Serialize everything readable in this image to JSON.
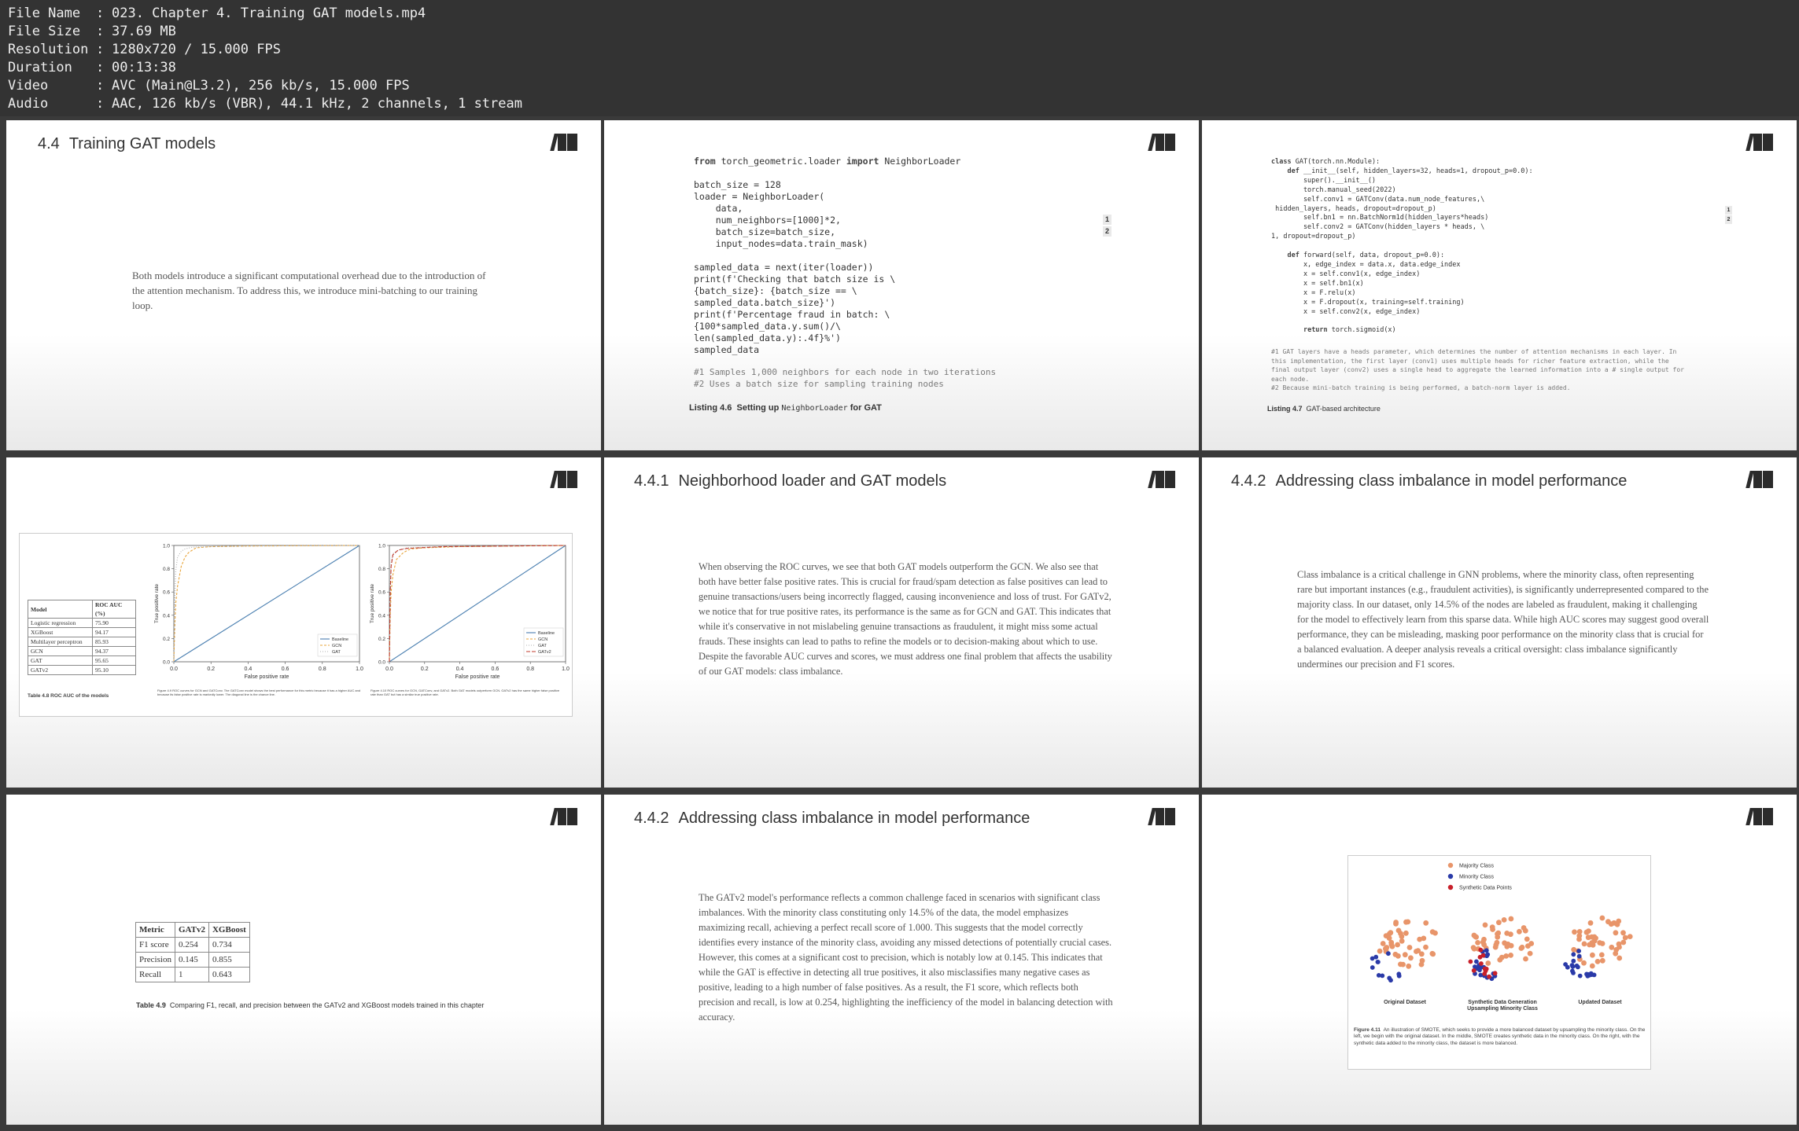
{
  "header": {
    "rows": [
      {
        "key": "File Name",
        "sep": ":",
        "value": "023. Chapter 4. Training GAT models.mp4"
      },
      {
        "key": "File Size",
        "sep": ":",
        "value": "37.69 MB"
      },
      {
        "key": "Resolution",
        "sep": ":",
        "value": "1280x720 / 15.000 FPS"
      },
      {
        "key": "Duration",
        "sep": ":",
        "value": "00:13:38"
      },
      {
        "key": "Video",
        "sep": ":",
        "value": "AVC (Main@L3.2), 256 kb/s, 15.000 FPS"
      },
      {
        "key": "Audio",
        "sep": ":",
        "value": "AAC, 126 kb/s (VBR), 44.1 kHz, 2 channels, 1 stream"
      }
    ]
  },
  "p1": {
    "num": "4.4",
    "title": "Training GAT models",
    "text": "Both models introduce a significant computational overhead due to the introduction of the attention mechanism. To address this, we introduce mini-batching to our training loop."
  },
  "p2": {
    "code": [
      "from torch_geometric.loader import NeighborLoader",
      "",
      "batch_size = 128",
      "loader = NeighborLoader(",
      "    data,",
      "    num_neighbors=[1000]*2,",
      "    batch_size=batch_size,",
      "    input_nodes=data.train_mask)",
      "",
      "sampled_data = next(iter(loader))",
      "print(f'Checking that batch size is \\",
      "{batch_size}: {batch_size == \\",
      "sampled_data.batch_size}')",
      "print(f'Percentage fraud in batch: \\",
      "{100*sampled_data.y.sum()/\\",
      "len(sampled_data.y):.4f}%')",
      "sampled_data"
    ],
    "comments": [
      "#1 Samples 1,000 neighbors for each node in two iterations",
      "#2 Uses a batch size for sampling training nodes"
    ],
    "badges": [
      "1",
      "2"
    ],
    "caption_label": "Listing 4.6",
    "caption_pre": "Setting up",
    "caption_code": "NeighborLoader",
    "caption_post": "for GAT"
  },
  "p3": {
    "code": [
      "class GAT(torch.nn.Module):",
      "    def __init__(self, hidden_layers=32, heads=1, dropout_p=0.0):",
      "        super().__init__()",
      "        torch.manual_seed(2022)",
      "        self.conv1 = GATConv(data.num_node_features,\\",
      " hidden_layers, heads, dropout=dropout_p)",
      "        self.bn1 = nn.BatchNorm1d(hidden_layers*heads)",
      "        self.conv2 = GATConv(hidden_layers * heads, \\",
      "1, dropout=dropout_p)",
      "",
      "    def forward(self, data, dropout_p=0.0):",
      "        x, edge_index = data.x, data.edge_index",
      "        x = self.conv1(x, edge_index)",
      "        x = self.bn1(x)",
      "        x = F.relu(x)",
      "        x = F.dropout(x, training=self.training)",
      "        x = self.conv2(x, edge_index)",
      "",
      "        return torch.sigmoid(x)"
    ],
    "comments": [
      "#1 GAT layers have a heads parameter, which determines the number of attention mechanisms in each layer. In",
      "this implementation, the first layer (conv1) uses multiple heads for richer feature extraction, while the",
      "final output layer (conv2) uses a single head to aggregate the learned information into a # single output for",
      "each node.",
      "#2 Because mini-batch training is being performed, a batch-norm layer is added."
    ],
    "badges": [
      "1",
      "2"
    ],
    "caption_label": "Listing 4.7",
    "caption_text": "GAT-based architecture"
  },
  "p4": {
    "table_headers": [
      "Model",
      "ROC AUC (%)"
    ],
    "table_rows": [
      [
        "Logistic regression",
        "75.90"
      ],
      [
        "XGBoost",
        "94.17"
      ],
      [
        "Multilayer perceptron",
        "85.93"
      ],
      [
        "GCN",
        "94.37"
      ],
      [
        "GAT",
        "95.65"
      ],
      [
        "GATv2",
        "95.10"
      ]
    ],
    "table_caption": "Table 4.8 ROC AUC of the models",
    "fig1_caption": "Figure 4.9 ROC curves for GCN and GATConv. The GATConv model shows the best performance for this metric because it has a higher AUC and because its false positive rate is markedly lower. The diagonal line is the chance line.",
    "fig2_caption": "Figure 4.10 ROC curves for GCN, GATConv, and GATv2. Both GAT models outperform GCN. GATv2 has the same higher false positive rate than GAT but has a similar true positive rate."
  },
  "chart_data": [
    {
      "type": "line",
      "xlabel": "False positive rate",
      "ylabel": "True positive rate",
      "xlim": [
        0,
        1
      ],
      "ylim": [
        0,
        1
      ],
      "xticks": [
        "0.0",
        "0.2",
        "0.4",
        "0.6",
        "0.8",
        "1.0"
      ],
      "yticks": [
        "0.0",
        "0.2",
        "0.4",
        "0.6",
        "0.8",
        "1.0"
      ],
      "legend": "bottom-right",
      "series": [
        {
          "name": "Baseline",
          "color": "#4a7fb0",
          "dash": "",
          "x": [
            0,
            1
          ],
          "y": [
            0,
            1
          ]
        },
        {
          "name": "GCN",
          "color": "#e8a43a",
          "dash": "3,2",
          "x": [
            0,
            0.005,
            0.01,
            0.02,
            0.04,
            0.06,
            0.08,
            0.1,
            0.12,
            0.2,
            0.4,
            1.0
          ],
          "y": [
            0,
            0.3,
            0.5,
            0.65,
            0.82,
            0.9,
            0.94,
            0.96,
            0.98,
            0.99,
            0.995,
            1.0
          ]
        },
        {
          "name": "GAT",
          "color": "#b0b0b0",
          "dash": "1,2",
          "x": [
            0,
            0.005,
            0.01,
            0.02,
            0.04,
            0.06,
            0.1,
            0.2,
            0.4,
            1.0
          ],
          "y": [
            0,
            0.55,
            0.78,
            0.9,
            0.95,
            0.97,
            0.985,
            0.99,
            0.995,
            1.0
          ]
        }
      ]
    },
    {
      "type": "line",
      "xlabel": "False positive rate",
      "ylabel": "True positive rate",
      "xlim": [
        0,
        1
      ],
      "ylim": [
        0,
        1
      ],
      "xticks": [
        "0.0",
        "0.2",
        "0.4",
        "0.6",
        "0.8",
        "1.0"
      ],
      "yticks": [
        "0.0",
        "0.2",
        "0.4",
        "0.6",
        "0.8",
        "1.0"
      ],
      "legend": "bottom-right",
      "series": [
        {
          "name": "Baseline",
          "color": "#4a7fb0",
          "dash": "",
          "x": [
            0,
            1
          ],
          "y": [
            0,
            1
          ]
        },
        {
          "name": "GCN",
          "color": "#e8a43a",
          "dash": "3,2",
          "x": [
            0,
            0.005,
            0.01,
            0.02,
            0.04,
            0.08,
            0.12,
            0.2,
            0.4,
            1.0
          ],
          "y": [
            0,
            0.4,
            0.6,
            0.75,
            0.88,
            0.94,
            0.97,
            0.98,
            0.99,
            1.0
          ]
        },
        {
          "name": "GAT",
          "color": "#b0b0b0",
          "dash": "1,2",
          "x": [
            0,
            0.005,
            0.01,
            0.02,
            0.05,
            0.1,
            0.3,
            1.0
          ],
          "y": [
            0,
            0.65,
            0.85,
            0.93,
            0.96,
            0.98,
            0.99,
            1.0
          ]
        },
        {
          "name": "GATv2",
          "color": "#c0392b",
          "dash": "5,2",
          "x": [
            0,
            0.005,
            0.01,
            0.02,
            0.05,
            0.1,
            0.3,
            1.0
          ],
          "y": [
            0,
            0.6,
            0.82,
            0.92,
            0.96,
            0.975,
            0.99,
            1.0
          ]
        }
      ]
    }
  ],
  "p5": {
    "num": "4.4.1",
    "title": "Neighborhood loader and GAT models",
    "text": "When observing the ROC curves, we see that both GAT models outperform the GCN. We also see that both have better false positive rates. This is crucial for fraud/spam detection as false positives can lead to genuine transactions/users being incorrectly flagged, causing inconvenience and loss of trust. For GATv2, we notice that for true positive rates, its performance is the same as for GCN and GAT. This indicates that while it's conservative in not mislabeling genuine transactions as fraudulent, it might miss some actual frauds. These insights can lead to paths to refine the models or to decision-making about which to use. Despite the favorable AUC curves and scores, we must address one final problem that affects the usability of our GAT models: class imbalance."
  },
  "p6": {
    "num": "4.4.2",
    "title": "Addressing class imbalance in model performance",
    "text": "Class imbalance is a critical challenge in GNN problems, where the minority class, often representing rare but important instances (e.g., fraudulent activities), is significantly underrepresented compared to the majority class. In our dataset, only 14.5% of the nodes are labeled as fraudulent, making it challenging for the model to effectively learn from this sparse data. While high AUC scores may suggest good overall performance, they can be misleading, masking poor performance on the minority class that is crucial for a balanced evaluation. A deeper analysis reveals a critical oversight: class imbalance significantly undermines our precision and F1 scores."
  },
  "p7": {
    "table_headers": [
      "Metric",
      "GATv2",
      "XGBoost"
    ],
    "table_rows": [
      [
        "F1 score",
        "0.254",
        "0.734"
      ],
      [
        "Precision",
        "0.145",
        "0.855"
      ],
      [
        "Recall",
        "1",
        "0.643"
      ]
    ],
    "caption_label": "Table 4.9",
    "caption_text": "Comparing F1, recall, and precision between the GATv2 and XGBoost models trained in this chapter"
  },
  "p8": {
    "num": "4.4.2",
    "title": "Addressing class imbalance in model performance",
    "text": "The GATv2 model's performance reflects a common challenge faced in scenarios with significant class imbalances. With the minority class constituting only 14.5% of the data, the model emphasizes maximizing recall, achieving a perfect recall score of 1.000. This suggests that the model correctly identifies every instance of the minority class, avoiding any missed detections of potentially crucial cases. However, this comes at a significant cost to precision, which is notably low at 0.145. This indicates that while the GAT is effective in detecting all true positives, it also misclassifies many negative cases as positive, leading to a high number of false positives. As a result, the F1 score, which reflects both precision and recall, is low at 0.254, highlighting the inefficiency of the model in balancing detection with accuracy."
  },
  "p9": {
    "legend": [
      {
        "label": "Majority Class",
        "color": "#e8956a"
      },
      {
        "label": "Minority Class",
        "color": "#2a3aa8"
      },
      {
        "label": "Synthetic Data Points",
        "color": "#c8202a"
      }
    ],
    "cluster_labels": [
      "Original Dataset",
      "Synthetic Data Generation\nUpsampling Minority Class",
      "Updated Dataset"
    ],
    "caption_label": "Figure 4.11",
    "caption_text": "An illustration of SMOTE, which seeks to provide a more balanced dataset by upsampling the minority class. On the left, we begin with the original dataset. In the middle, SMOTE creates synthetic data in the minority class. On the right, with the synthetic data added to the minority class, the dataset is more balanced."
  }
}
